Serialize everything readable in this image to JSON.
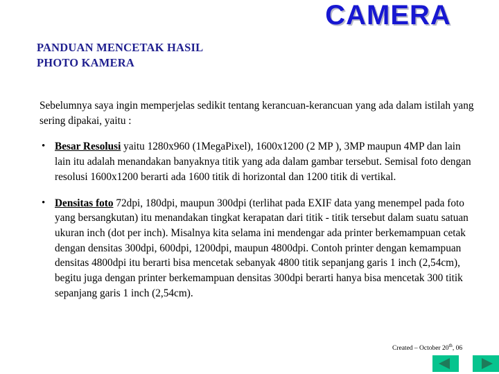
{
  "slide": {
    "banner_title": "CAMERA",
    "subheading_lines": [
      "PANDUAN MENCETAK HASIL",
      "PHOTO KAMERA"
    ],
    "intro_paragraph": "Sebelumnya saya ingin memperjelas sedikit tentang kerancuan-kerancuan yang ada dalam istilah yang sering dipakai, yaitu :",
    "bullets": [
      {
        "marker": "•",
        "term": "Besar Resolusi",
        "text": " yaitu 1280x960 (1MegaPixel), 1600x1200 (2 MP ), 3MP maupun 4MP dan lain lain itu adalah menandakan banyaknya titik yang ada dalam gambar tersebut. Semisal foto dengan resolusi 1600x1200 berarti ada 1600 titik di horizontal dan 1200 titik di vertikal."
      },
      {
        "marker": "•",
        "term": "Densitas foto",
        "text": " 72dpi, 180dpi, maupun 300dpi (terlihat pada EXIF data yang menempel pada foto yang bersangkutan) itu menandakan tingkat kerapatan dari titik - titik tersebut dalam suatu satuan ukuran inch (dot per inch). Misalnya kita selama ini mendengar ada printer berkemampuan cetak dengan densitas 300dpi, 600dpi, 1200dpi, maupun 4800dpi. Contoh printer dengan kemampuan densitas 4800dpi itu berarti bisa mencetak sebanyak 4800 titik sepanjang garis 1 inch (2,54cm), begitu juga dengan printer berkemampuan densitas 300dpi berarti hanya bisa mencetak 300 titik sepanjang garis 1 inch (2,54cm)."
      }
    ],
    "credit": {
      "prefix": "Created – October 20",
      "ordinal": "th",
      "suffix": ", 06"
    },
    "navigation": {
      "previous_label": "previous-slide",
      "next_label": "next-slide"
    },
    "colors": {
      "background": "#ffffff",
      "banner_title": "#1717d1",
      "subheading": "#1f1f8f",
      "body_text": "#000000",
      "nav_button_bg": "#06c48e",
      "nav_arrow": "#1f7a5a"
    }
  }
}
